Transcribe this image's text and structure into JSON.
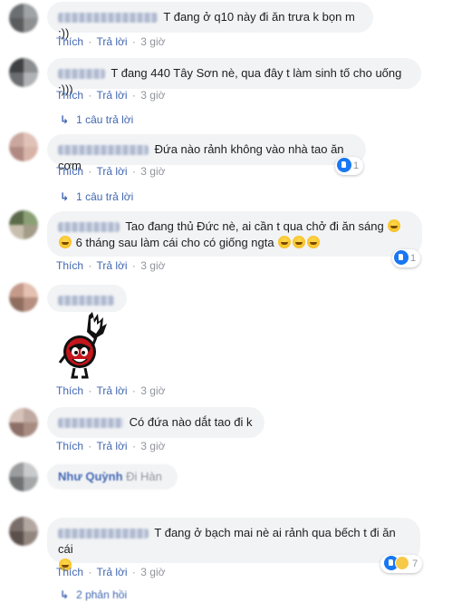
{
  "actions": {
    "like": "Thích",
    "reply": "Trả lời",
    "sep": "·"
  },
  "comments": [
    {
      "text": "T đang ở q10 này đi ăn trưa k bọn m :))",
      "time": "3 giờ"
    },
    {
      "text": "T đang 440 Tây Sơn nè, qua đây t làm sinh tố cho uống :)))",
      "time": "3 giờ",
      "replies": "1 câu trả lời"
    },
    {
      "text": "Đứa nào rảnh không vào nhà tao ăn cơm",
      "time": "3 giờ",
      "reactions": "1",
      "replies": "1 câu trả lời"
    },
    {
      "text_line1": "Tao đang thủ Đức nè, ai cần t qua chở đi ăn sáng",
      "text_line2": "6 tháng sau làm cái cho có giống ngta",
      "time": "3 giờ",
      "reactions": "1"
    },
    {
      "time": "3 giờ"
    },
    {
      "text": "Có đứa nào dắt tao đi k",
      "time": "3 giờ"
    },
    {
      "partial": "Như Quỳnh",
      "partial_tail": "Đi Hàn"
    },
    {
      "text": "T đang ở bạch mai nè ai rảnh qua bếch t đi ăn cái",
      "time": "3 giờ",
      "reactions": "7"
    }
  ],
  "footer": {
    "partial": "2 phản hồi"
  },
  "colors": {
    "link": "#4267b2",
    "meta": "#90949c",
    "bubble": "#f2f3f5",
    "like": "#1877f2"
  }
}
